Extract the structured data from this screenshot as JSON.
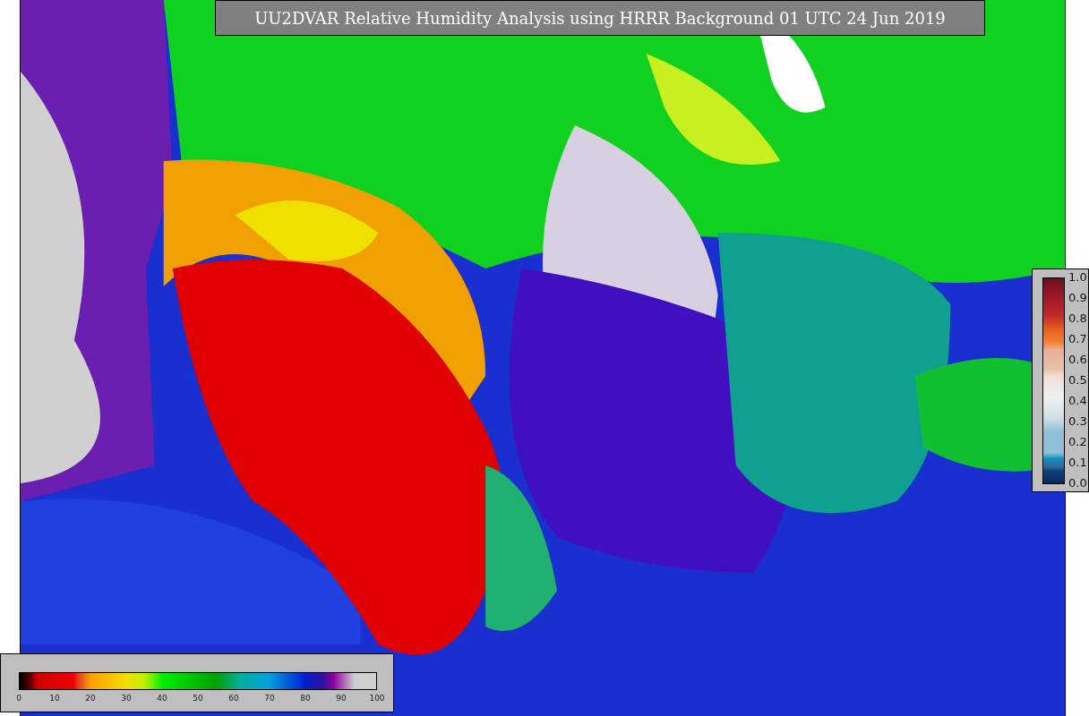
{
  "title": "UU2DVAR Relative Humidity Analysis using HRRR Background 01 UTC 24 Jun 2019",
  "humidity_legend": {
    "ticks": [
      "0",
      "10",
      "20",
      "30",
      "40",
      "50",
      "60",
      "70",
      "80",
      "90",
      "100"
    ]
  },
  "ratio_legend": {
    "ticks": [
      "1.0",
      "0.9",
      "0.8",
      "0.7",
      "0.6",
      "0.5",
      "0.4",
      "0.3",
      "0.2",
      "0.1",
      "0.0"
    ]
  }
}
